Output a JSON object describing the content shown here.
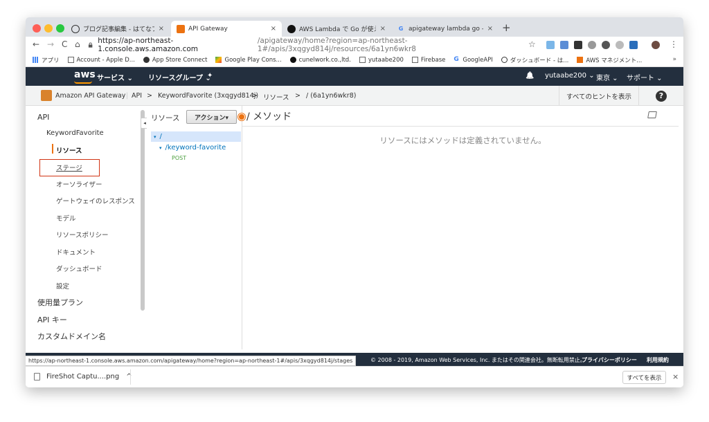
{
  "browser": {
    "tabs": [
      {
        "title": "ブログ記事編集 - はてなブログ",
        "active": false
      },
      {
        "title": "API Gateway",
        "active": true
      },
      {
        "title": "AWS Lambda で Go が使えるよ",
        "active": false
      },
      {
        "title": "apigateway lambda go - Googl",
        "active": false
      }
    ],
    "tab_close": "×",
    "new_tab": "+",
    "url_host": "https://ap-northeast-1.console.aws.amazon.com",
    "url_path": "/apigateway/home?region=ap-northeast-1#/apis/3xqgyd814j/resources/6a1yn6wkr8",
    "back": "←",
    "forward": "→",
    "reload": "C",
    "home": "⌂",
    "star": "☆",
    "menu": "⋮"
  },
  "bookmarks": {
    "items": [
      {
        "label": "アプリ",
        "icon": "apps-grid-icon"
      },
      {
        "label": "Account - Apple D...",
        "icon": "page-icon"
      },
      {
        "label": "App Store Connect",
        "icon": "apple-icon"
      },
      {
        "label": "Google Play Cons...",
        "icon": "play-icon"
      },
      {
        "label": "cunelwork.co.,ltd.",
        "icon": "github-icon"
      },
      {
        "label": "yutaabe200",
        "icon": "page-icon"
      },
      {
        "label": "Firebase",
        "icon": "page-icon"
      },
      {
        "label": "GoogleAPI",
        "icon": "google-icon"
      },
      {
        "label": "ダッシュボード - は...",
        "icon": "hatena-icon"
      },
      {
        "label": "AWS マネジメント...",
        "icon": "aws-icon"
      }
    ],
    "more": "»"
  },
  "aws_header": {
    "logo": "aws",
    "services": "サービス ⌄",
    "resource_groups": "リソースグループ ⌄",
    "pin": "✦",
    "bell": "🔔",
    "user": "yutaabe200 ⌄",
    "region": "東京 ⌄",
    "support": "サポート ⌄"
  },
  "breadcrumb": {
    "service": "Amazon API Gateway",
    "api": "API",
    "sep": ">",
    "api_name": "KeywordFavorite (3xqgyd814j)",
    "resources": "リソース",
    "resource_path": "/ (6a1yn6wkr8)",
    "show_hints": "すべてのヒントを表示",
    "help": "?"
  },
  "sidebar": {
    "api": "API",
    "api_name": "KeywordFavorite",
    "items": [
      "リソース",
      "ステージ",
      "オーソライザー",
      "ゲートウェイのレスポンス",
      "モデル",
      "リソースポリシー",
      "ドキュメント",
      "ダッシュボード",
      "設定"
    ],
    "usage_plans": "使用量プラン",
    "api_keys": "API キー",
    "custom_domains": "カスタムドメイン名",
    "toggle": "◂"
  },
  "resources_panel": {
    "title": "リソース",
    "actions": "アクション▾",
    "root": "/",
    "child": "/keyword-favorite",
    "method": "POST",
    "tri": "▾"
  },
  "main": {
    "title": "/ メソッド",
    "message": "リソースにはメソッドは定義されていません。"
  },
  "footer": {
    "copyright": "© 2008 - 2019, Amazon Web Services, Inc. またはその関連会社。無断転用禁止。",
    "privacy": "プライバシーポリシー",
    "terms": "利用規約",
    "status_url": "https://ap-northeast-1.console.aws.amazon.com/apigateway/home?region=ap-northeast-1#/apis/3xqgyd814j/stages"
  },
  "downloads": {
    "file": "FireShot Captu....png",
    "caret": "^",
    "show_all": "すべてを表示",
    "close": "×"
  }
}
